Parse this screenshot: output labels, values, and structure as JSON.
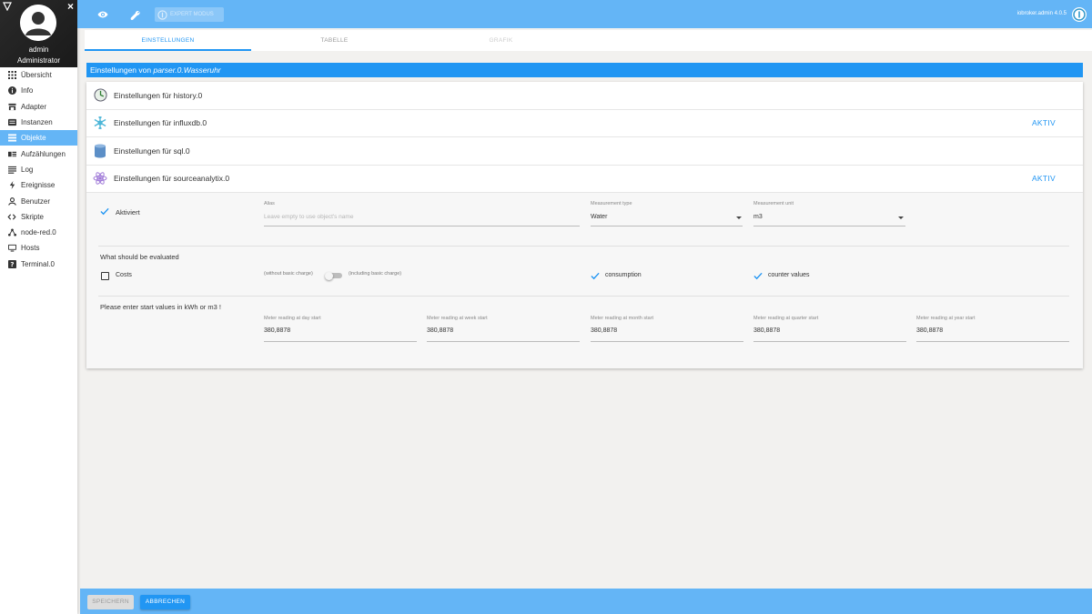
{
  "sidebar": {
    "user_name": "admin",
    "user_role": "Administrator",
    "items": [
      {
        "label": "Übersicht",
        "icon": "grid-icon"
      },
      {
        "label": "Info",
        "icon": "info-icon"
      },
      {
        "label": "Adapter",
        "icon": "store-icon"
      },
      {
        "label": "Instanzen",
        "icon": "instances-icon"
      },
      {
        "label": "Objekte",
        "icon": "objects-icon",
        "active": true
      },
      {
        "label": "Aufzählungen",
        "icon": "enums-icon"
      },
      {
        "label": "Log",
        "icon": "log-icon"
      },
      {
        "label": "Ereignisse",
        "icon": "events-icon"
      },
      {
        "label": "Benutzer",
        "icon": "user-icon"
      },
      {
        "label": "Skripte",
        "icon": "code-icon"
      },
      {
        "label": "node-red.0",
        "icon": "node-red-icon"
      },
      {
        "label": "Hosts",
        "icon": "hosts-icon"
      },
      {
        "label": "Terminal.0",
        "icon": "terminal-icon"
      }
    ]
  },
  "topbar": {
    "host_label": "iobroker.admin 4.0.5",
    "disabled_button_label": "EXPERT MODUS"
  },
  "tabs": [
    {
      "label": "EINSTELLUNGEN",
      "state": "active"
    },
    {
      "label": "TABELLE",
      "state": "normal"
    },
    {
      "label": "GRAFIK",
      "state": "disabled"
    }
  ],
  "settings": {
    "header_prefix": "Einstellungen von ",
    "object_id": "parser.0.Wasseruhr",
    "adapters": [
      {
        "label": "Einstellungen für history.0",
        "status": "",
        "icon": "history-icon"
      },
      {
        "label": "Einstellungen für influxdb.0",
        "status": "AKTIV",
        "icon": "influxdb-icon"
      },
      {
        "label": "Einstellungen für sql.0",
        "status": "",
        "icon": "sql-icon"
      },
      {
        "label": "Einstellungen für sourceanalytix.0",
        "status": "AKTIV",
        "icon": "sourceanalytix-icon"
      }
    ]
  },
  "sourceanalytix": {
    "activated_label": "Aktiviert",
    "alias_label": "Alias",
    "alias_placeholder": "Leave empty to use object's name",
    "measurement_type_label": "Measurement type",
    "measurement_type_value": "Water",
    "measurement_unit_label": "Measurement unit",
    "measurement_unit_value": "m3",
    "evaluate_heading": "What should be evaluated",
    "costs_label": "Costs",
    "without_basic_charge": "(without basic charge)",
    "including_basic_charge": "(including basic charge)",
    "consumption_label": "consumption",
    "counter_values_label": "counter values",
    "start_values_heading": "Please enter start values in kWh or m3 !",
    "readings": [
      {
        "label": "Meter reading at day start",
        "value": "380,8878"
      },
      {
        "label": "Meter reading at week start",
        "value": "380,8878"
      },
      {
        "label": "Meter reading at month start",
        "value": "380,8878"
      },
      {
        "label": "Meter reading at quarter start",
        "value": "380,8878"
      },
      {
        "label": "Meter reading at year start",
        "value": "380,8878"
      }
    ]
  },
  "footer": {
    "save_label": "SPEICHERN",
    "cancel_label": "ABBRECHEN"
  },
  "colors": {
    "primary": "#2196f3",
    "topbar": "#64b5f6"
  }
}
